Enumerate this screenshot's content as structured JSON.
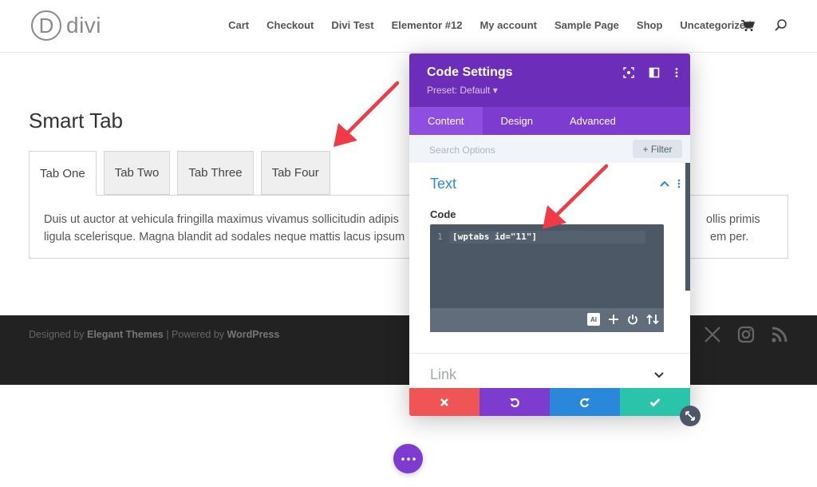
{
  "header": {
    "logo_letter": "D",
    "logo_text": "divi",
    "nav": [
      "Cart",
      "Checkout",
      "Divi Test",
      "Elementor #12",
      "My account",
      "Sample Page",
      "Shop",
      "Uncategorized"
    ]
  },
  "content": {
    "title": "Smart Tab",
    "tabs": [
      "Tab One",
      "Tab Two",
      "Tab Three",
      "Tab Four"
    ],
    "active_tab": "Tab One",
    "panel_line1_left": "Duis ut auctor at vehicula fringilla maximus vivamus sollicitudin adipis",
    "panel_line1_right": "ollis primis",
    "panel_line2_left": "ligula scelerisque. Magna blandit ad sodales neque mattis lacus ipsum",
    "panel_line2_right": "em per."
  },
  "footer": {
    "designed_by": "Designed by",
    "elegant": "Elegant Themes",
    "separator": " | Powered by ",
    "wordpress": "WordPress"
  },
  "modal": {
    "title": "Code Settings",
    "preset": "Preset: Default ▾",
    "tabs": [
      "Content",
      "Design",
      "Advanced"
    ],
    "active_tab": "Content",
    "search_placeholder": "Search Options",
    "filter_label": "+ Filter",
    "section_text": "Text",
    "code_label": "Code",
    "line_number": "1",
    "code_value": "[wptabs id=\"11\"]",
    "ai_label": "AI",
    "section_link": "Link"
  },
  "colors": {
    "modal_header": "#6c2eb9",
    "modal_tabs": "#7e3bd0",
    "accent_blue": "#2b87da",
    "cancel": "#ef5555",
    "save": "#29c4a9",
    "arrow": "#f03a47"
  }
}
